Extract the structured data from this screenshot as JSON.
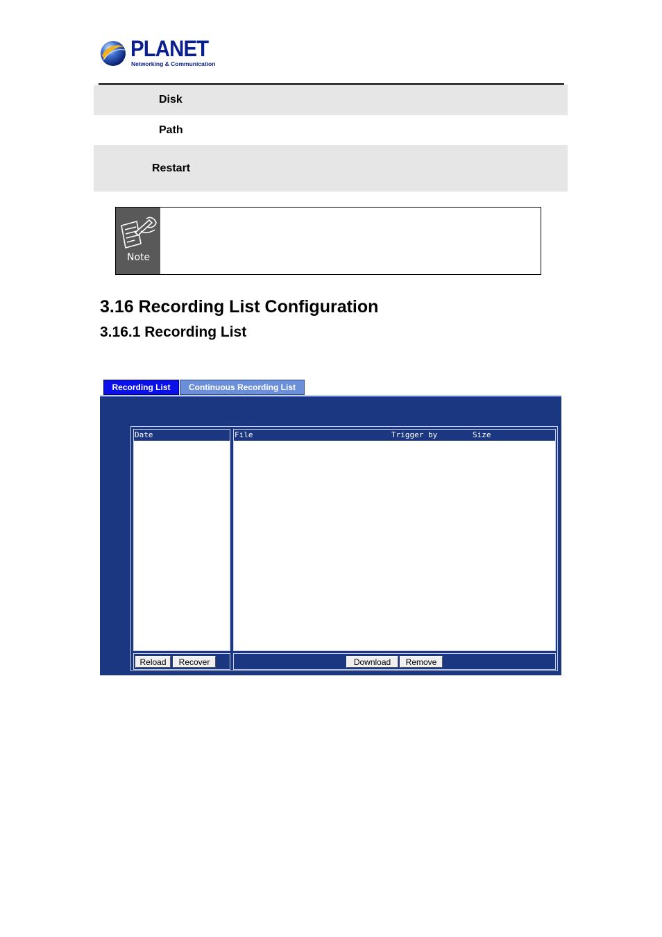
{
  "logo": {
    "name": "PLANET",
    "tagline": "Networking & Communication"
  },
  "settings_rows": [
    {
      "label": "Disk"
    },
    {
      "label": "Path"
    },
    {
      "label": "Restart"
    }
  ],
  "note": {
    "label": "Note"
  },
  "section_title": "3.16 Recording List Configuration",
  "subsection_title": "3.16.1 Recording List",
  "tabs": [
    {
      "label": "Recording List",
      "active": true
    },
    {
      "label": "Continuous Recording List",
      "active": false
    }
  ],
  "date_list": {
    "header": "Date"
  },
  "file_list": {
    "header_file": "File",
    "header_trigger": "Trigger by",
    "header_size": "Size"
  },
  "buttons": {
    "reload": "Reload",
    "recover": "Recover",
    "download": "Download",
    "remove": "Remove"
  },
  "colors": {
    "panel_bg": "#1b3782",
    "tab_active": "#0a10e8",
    "tab_inactive": "#6b8fd8",
    "brand": "#0a1f8f"
  }
}
